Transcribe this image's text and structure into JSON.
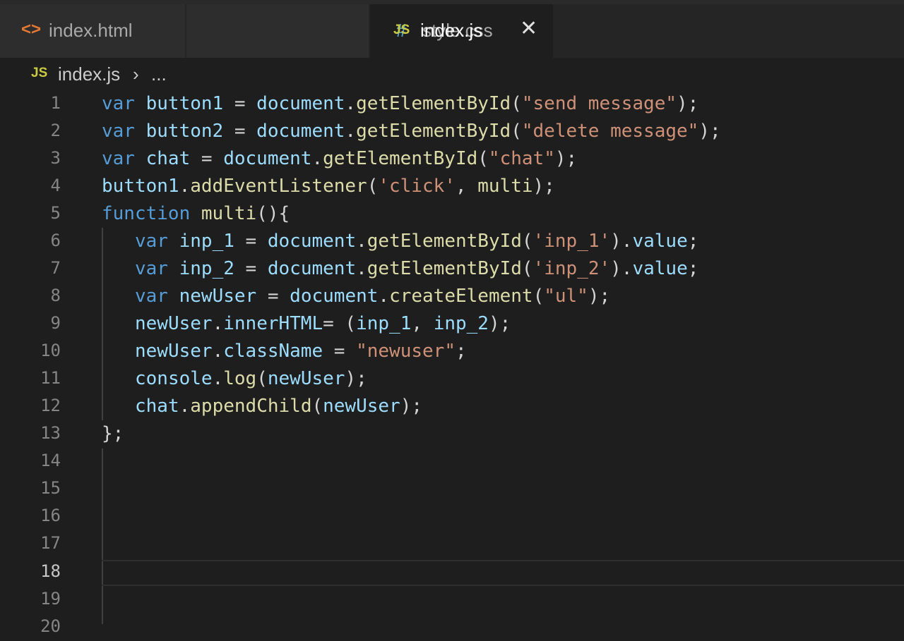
{
  "tabs": [
    {
      "icon": "<>",
      "label": "index.html"
    },
    {
      "icon": "#",
      "label": "style.css"
    },
    {
      "icon": "JS",
      "label": "index.js",
      "active": true
    }
  ],
  "close_glyph": "✕",
  "breadcrumb": {
    "icon": "JS",
    "file": "index.js",
    "separator": "›",
    "more": "..."
  },
  "line_numbers": [
    "1",
    "2",
    "3",
    "4",
    "5",
    "6",
    "7",
    "8",
    "9",
    "10",
    "11",
    "12",
    "13",
    "14",
    "15",
    "16",
    "17",
    "18",
    "19",
    "20"
  ],
  "active_line": "18",
  "code": {
    "l1": {
      "a": "var",
      "b": "button1",
      "c": " = ",
      "d": "document",
      "e": ".",
      "f": "getElementById",
      "g": "(",
      "h": "\"send message\"",
      "i": ");"
    },
    "l2": {
      "a": "var",
      "b": "button2",
      "c": " = ",
      "d": "document",
      "e": ".",
      "f": "getElementById",
      "g": "(",
      "h": "\"delete message\"",
      "i": ");"
    },
    "l3": {
      "a": "var",
      "b": "chat",
      "c": " = ",
      "d": "document",
      "e": ".",
      "f": "getElementById",
      "g": "(",
      "h": "\"chat\"",
      "i": ");"
    },
    "l4": {
      "a": "button1",
      "b": ".",
      "c": "addEventListener",
      "d": "(",
      "e": "'click'",
      "f": ", ",
      "g": "multi",
      "h": ");"
    },
    "l5": {
      "a": "function",
      "b": " ",
      "c": "multi",
      "d": "(){"
    },
    "l6": {
      "a": "var",
      "b": "inp_1",
      "c": " = ",
      "d": "document",
      "e": ".",
      "f": "getElementById",
      "g": "(",
      "h": "'inp_1'",
      "i": ").",
      "j": "value",
      "k": ";"
    },
    "l7": {
      "a": "var",
      "b": "inp_2",
      "c": " = ",
      "d": "document",
      "e": ".",
      "f": "getElementById",
      "g": "(",
      "h": "'inp_2'",
      "i": ").",
      "j": "value",
      "k": ";"
    },
    "l8": {
      "a": "var",
      "b": "newUser",
      "c": " = ",
      "d": "document",
      "e": ".",
      "f": "createElement",
      "g": "(",
      "h": "\"ul\"",
      "i": ");"
    },
    "l9": {
      "a": "newUser",
      "b": ".",
      "c": "innerHTML",
      "d": "= (",
      "e": "inp_1",
      "f": ", ",
      "g": "inp_2",
      "h": ");"
    },
    "l10": {
      "a": "newUser",
      "b": ".",
      "c": "className",
      "d": " = ",
      "e": "\"newuser\"",
      "f": ";"
    },
    "l11": {
      "a": "console",
      "b": ".",
      "c": "log",
      "d": "(",
      "e": "newUser",
      "f": ");"
    },
    "l12": {
      "a": "chat",
      "b": ".",
      "c": "appendChild",
      "d": "(",
      "e": "newUser",
      "f": ");"
    },
    "l13": {
      "a": "};"
    }
  }
}
